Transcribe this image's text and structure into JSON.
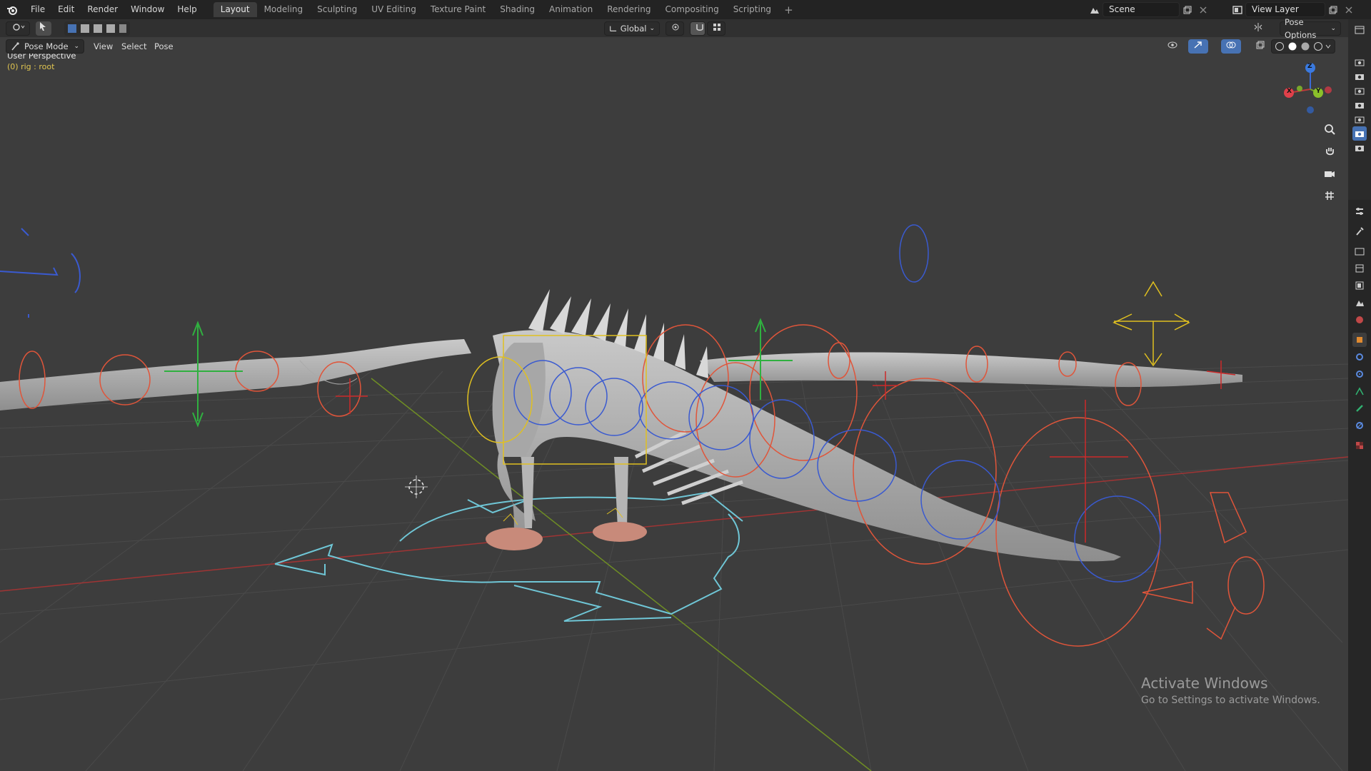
{
  "topbar": {
    "menus": [
      "File",
      "Edit",
      "Render",
      "Window",
      "Help"
    ],
    "workspaces": [
      "Layout",
      "Modeling",
      "Sculpting",
      "UV Editing",
      "Texture Paint",
      "Shading",
      "Animation",
      "Rendering",
      "Compositing",
      "Scripting"
    ],
    "active_workspace": "Layout",
    "add_tab": "+",
    "scene": "Scene",
    "view_layer": "View Layer"
  },
  "header": {
    "orientation": "Global",
    "pose_options": "Pose Options"
  },
  "viewport_header": {
    "mode": "Pose Mode",
    "view": "View",
    "select": "Select",
    "pose": "Pose"
  },
  "viewport": {
    "perspective": "User Perspective",
    "object_info": "(0) rig : root"
  },
  "gizmo": {
    "x": "X",
    "y": "Y",
    "z": "Z"
  },
  "watermark": {
    "title": "Activate Windows",
    "subtitle": "Go to Settings to activate Windows."
  },
  "colors": {
    "bone_orange": "#e0553a",
    "bone_blue": "#3a5ad0",
    "bone_yellow": "#e0c020",
    "bone_green": "#30b040",
    "root_cyan": "#6fc6d6",
    "axis_red": "#b03838",
    "axis_green": "#7a9a2a"
  }
}
